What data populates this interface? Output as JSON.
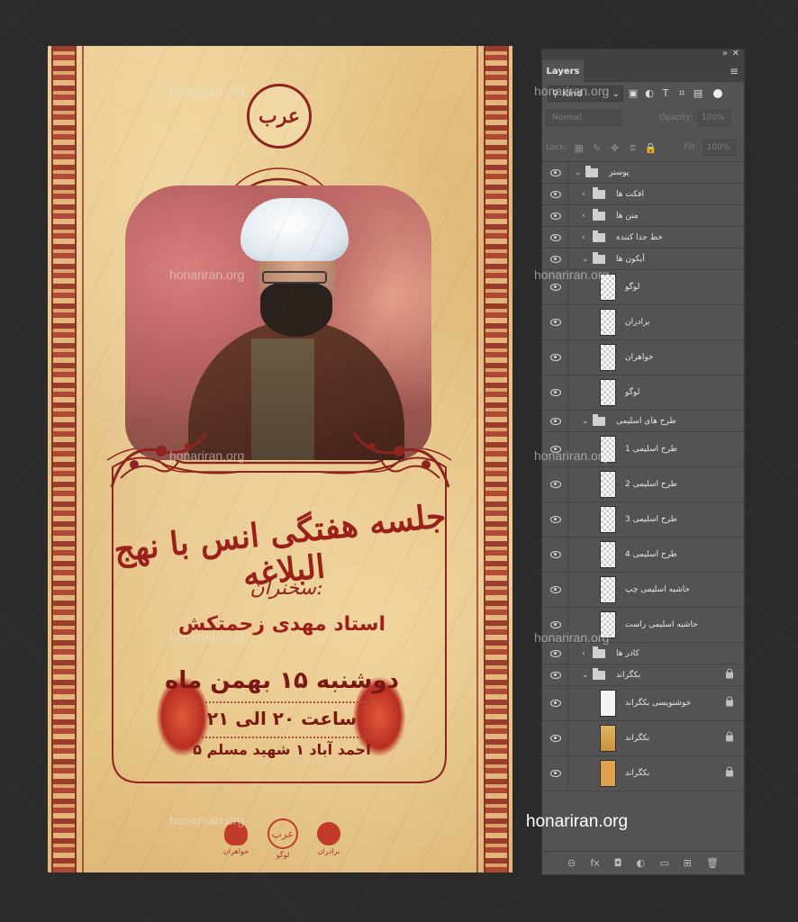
{
  "watermark": {
    "text": "honariran.org"
  },
  "poster": {
    "logo_text": "عرب",
    "title": "جلسه هفتگی انس با نهج البلاغه",
    "speaker_tag": "سخنران:",
    "speaker_name": "استاد مهدی زحمتکش",
    "date": "دوشنبه ۱۵ بهمن ماه",
    "time": "ساعت ۲۰ الی ۲۱",
    "address": "احمد آباد ۱ شهید مسلم ۵",
    "footer_icons": [
      {
        "name": "sisters",
        "caption": "خواهران"
      },
      {
        "name": "logo",
        "caption": "لوگو",
        "glyph": "عرب"
      },
      {
        "name": "brothers",
        "caption": "برادران"
      }
    ]
  },
  "layers_panel": {
    "tab_label": "Layers",
    "filter_kind": "Kind",
    "blend_mode": "Normal",
    "opacity_label": "Opacity:",
    "opacity_value": "100%",
    "lock_label": "Lock:",
    "fill_label": "Fill:",
    "fill_value": "100%",
    "layers": [
      {
        "name": "پوستر",
        "type": "group",
        "expanded": true,
        "indent": 0
      },
      {
        "name": "افکت ها",
        "type": "group",
        "expanded": false,
        "indent": 1
      },
      {
        "name": "متن ها",
        "type": "group",
        "expanded": false,
        "indent": 1
      },
      {
        "name": "خط جدا کننده",
        "type": "group",
        "expanded": false,
        "indent": 1
      },
      {
        "name": "آیکون ها",
        "type": "group",
        "expanded": true,
        "indent": 1
      },
      {
        "name": "لوگو",
        "type": "layer",
        "indent": 2
      },
      {
        "name": "برادران",
        "type": "layer",
        "indent": 2
      },
      {
        "name": "خواهران",
        "type": "layer",
        "indent": 2
      },
      {
        "name": "لوگو",
        "type": "layer",
        "indent": 2
      },
      {
        "name": "طرح های اسلیمی",
        "type": "group",
        "expanded": true,
        "indent": 1
      },
      {
        "name": "طرح اسلیمی 1",
        "type": "layer",
        "indent": 2
      },
      {
        "name": "طرح اسلیمی 2",
        "type": "layer",
        "indent": 2
      },
      {
        "name": "طرح اسلیمی 3",
        "type": "layer",
        "indent": 2
      },
      {
        "name": "طرح اسلیمی 4",
        "type": "layer",
        "indent": 2
      },
      {
        "name": "حاشیه اسلیمی چپ",
        "type": "layer",
        "indent": 2
      },
      {
        "name": "حاشیه اسلیمی راست",
        "type": "layer",
        "indent": 2
      },
      {
        "name": "کادر ها",
        "type": "group",
        "expanded": false,
        "indent": 1
      },
      {
        "name": "بکگراند",
        "type": "group",
        "expanded": true,
        "indent": 1,
        "locked": true
      },
      {
        "name": "خوشنویسی بکگراند",
        "type": "layer",
        "indent": 2,
        "locked": true,
        "thumb": "callig"
      },
      {
        "name": "بکگراند",
        "type": "layer",
        "indent": 2,
        "locked": true,
        "thumb": "photo"
      },
      {
        "name": "بکگراند",
        "type": "layer",
        "indent": 2,
        "locked": true,
        "thumb": "orange"
      }
    ],
    "footer_icons": [
      "link-icon",
      "fx-icon",
      "mask-icon",
      "adjustment-icon",
      "new-group-icon",
      "new-layer-icon",
      "trash-icon"
    ],
    "footer_glyphs": [
      "⊝",
      "fx",
      "◘",
      "◐",
      "▭",
      "⊞",
      "🗑"
    ]
  }
}
